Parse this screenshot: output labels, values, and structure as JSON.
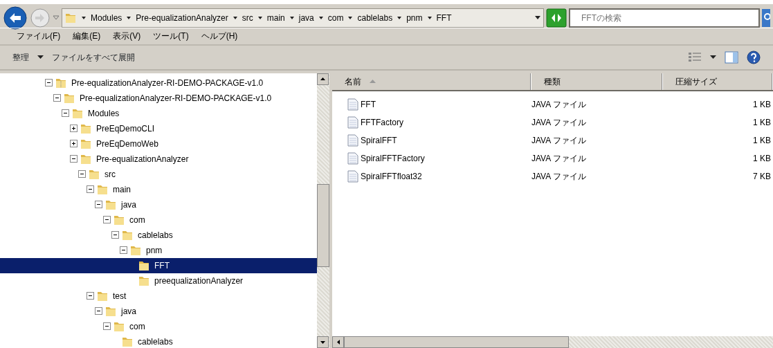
{
  "address_bar": {
    "crumbs": [
      "Modules",
      "Pre-equalizationAnalyzer",
      "src",
      "main",
      "java",
      "com",
      "cablelabs",
      "pnm",
      "FFT"
    ]
  },
  "search": {
    "placeholder": "FFTの検索"
  },
  "menu": [
    "ファイル(F)",
    "編集(E)",
    "表示(V)",
    "ツール(T)",
    "ヘルプ(H)"
  ],
  "toolbar": {
    "buttons": [
      {
        "label": "整理",
        "dropdown": true
      },
      {
        "label": "ファイルをすべて展開",
        "dropdown": false
      }
    ]
  },
  "tree": [
    {
      "label": "Pre-equalizationAnalyzer-RI-DEMO-PACKAGE-v1.0",
      "kind": "zip",
      "expanded": true,
      "selected": false,
      "children": [
        {
          "label": "Pre-equalizationAnalyzer-RI-DEMO-PACKAGE-v1.0",
          "kind": "folder",
          "expanded": true,
          "selected": false,
          "children": [
            {
              "label": "Modules",
              "kind": "folder",
              "expanded": true,
              "selected": false,
              "children": [
                {
                  "label": "PreEqDemoCLI",
                  "kind": "folder",
                  "expanded": false,
                  "selected": false
                },
                {
                  "label": "PreEqDemoWeb",
                  "kind": "folder",
                  "expanded": false,
                  "selected": false
                },
                {
                  "label": "Pre-equalizationAnalyzer",
                  "kind": "folder",
                  "expanded": true,
                  "selected": false,
                  "children": [
                    {
                      "label": "src",
                      "kind": "folder",
                      "expanded": true,
                      "selected": false,
                      "children": [
                        {
                          "label": "main",
                          "kind": "folder",
                          "expanded": true,
                          "selected": false,
                          "children": [
                            {
                              "label": "java",
                              "kind": "folder",
                              "expanded": true,
                              "selected": false,
                              "children": [
                                {
                                  "label": "com",
                                  "kind": "folder",
                                  "expanded": true,
                                  "selected": false,
                                  "children": [
                                    {
                                      "label": "cablelabs",
                                      "kind": "folder",
                                      "expanded": true,
                                      "selected": false,
                                      "children": [
                                        {
                                          "label": "pnm",
                                          "kind": "folder",
                                          "expanded": true,
                                          "selected": false,
                                          "children": [
                                            {
                                              "label": "FFT",
                                              "kind": "folder",
                                              "selected": true
                                            },
                                            {
                                              "label": "preequalizationAnalyzer",
                                              "kind": "folder",
                                              "selected": false
                                            }
                                          ]
                                        }
                                      ]
                                    }
                                  ]
                                }
                              ]
                            }
                          ]
                        },
                        {
                          "label": "test",
                          "kind": "folder",
                          "expanded": true,
                          "selected": false,
                          "children": [
                            {
                              "label": "java",
                              "kind": "folder",
                              "expanded": true,
                              "selected": false,
                              "children": [
                                {
                                  "label": "com",
                                  "kind": "folder",
                                  "expanded": true,
                                  "selected": false,
                                  "children": [
                                    {
                                      "label": "cablelabs",
                                      "kind": "folder",
                                      "selected": false
                                    }
                                  ]
                                }
                              ]
                            }
                          ]
                        }
                      ]
                    }
                  ]
                }
              ]
            }
          ]
        }
      ]
    }
  ],
  "table": {
    "columns": [
      {
        "label": "名前",
        "sorted": true
      },
      {
        "label": "種類",
        "sorted": false
      },
      {
        "label": "圧縮サイズ",
        "sorted": false
      }
    ],
    "rows": [
      {
        "name": "FFT",
        "type": "JAVA ファイル",
        "size": "1 KB"
      },
      {
        "name": "FFTFactory",
        "type": "JAVA ファイル",
        "size": "1 KB"
      },
      {
        "name": "SpiralFFT",
        "type": "JAVA ファイル",
        "size": "1 KB"
      },
      {
        "name": "SpiralFFTFactory",
        "type": "JAVA ファイル",
        "size": "1 KB"
      },
      {
        "name": "SpiralFFTfloat32",
        "type": "JAVA ファイル",
        "size": "7 KB"
      }
    ]
  }
}
